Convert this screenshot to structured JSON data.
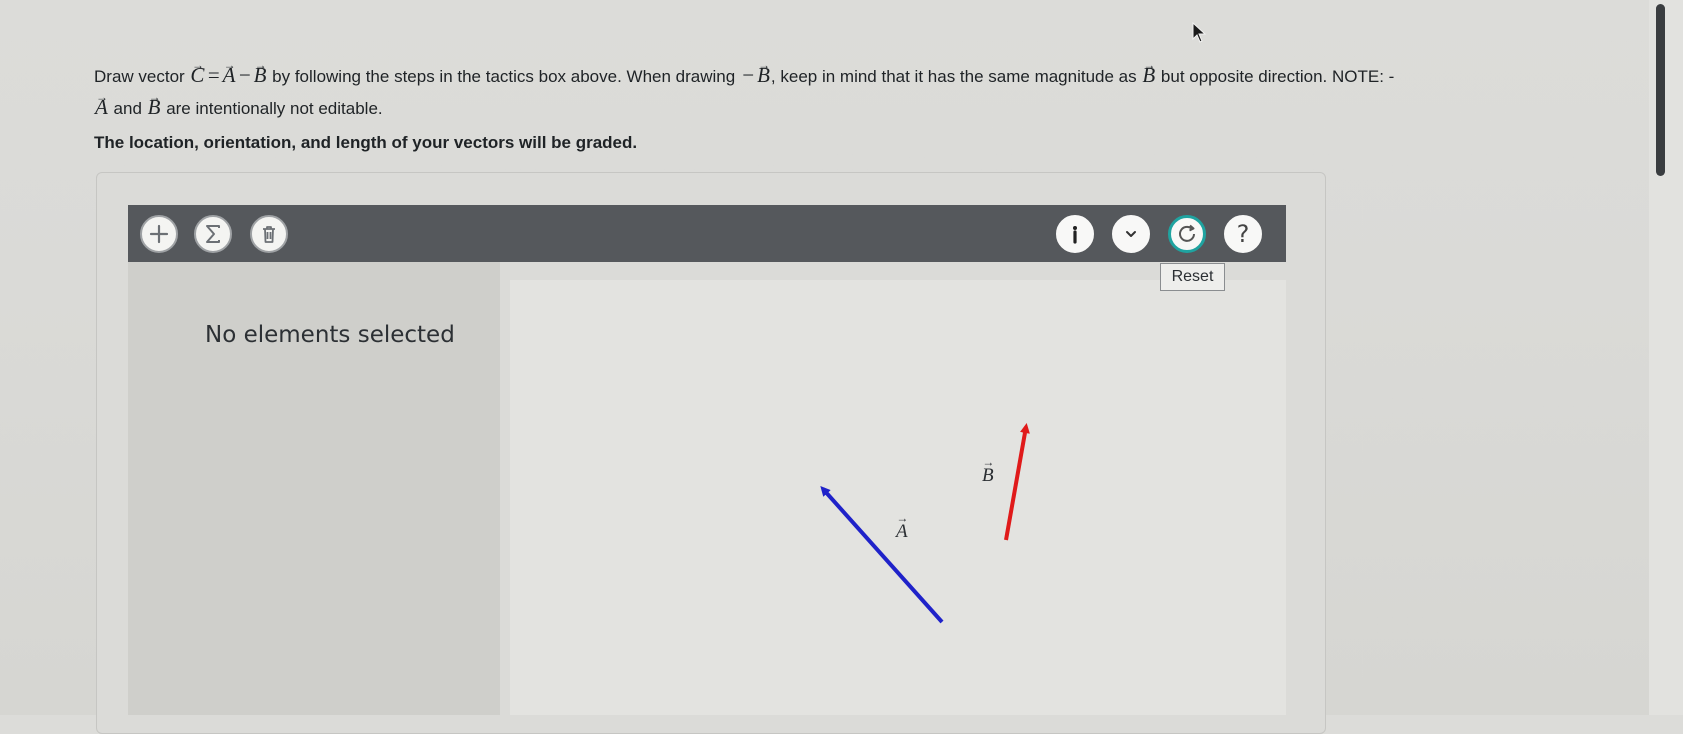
{
  "prompt": {
    "t1": "Draw vector ",
    "C": "C",
    "eq": " = ",
    "A": "A",
    "minus": " − ",
    "B": "B",
    "t2": " by following the steps in the tactics box above. When drawing ",
    "negB_minus": "−",
    "negB": "B",
    "t3": ", keep in mind that it has the same magnitude as ",
    "B2": "B",
    "t4": " but opposite direction. NOTE: -",
    "A2": "A",
    "t5": " and ",
    "B3": "B",
    "t6": " are intentionally not editable."
  },
  "grading_note": "The location, orientation, and length of your vectors will be graded.",
  "toolbar": {
    "add_icon": "plus-icon",
    "sum_icon": "sigma-icon",
    "delete_icon": "trash-icon",
    "info_icon": "info-icon",
    "dropdown_icon": "chevron-down-icon",
    "reset_icon": "reset-icon",
    "help_icon": "question-icon",
    "help_glyph": "?",
    "reset_tooltip": "Reset",
    "accent_color": "#1fa3a0"
  },
  "side_panel": {
    "status": "No elements selected"
  },
  "vectors": [
    {
      "name": "A",
      "label": "A",
      "color": "#1f22c9"
    },
    {
      "name": "B",
      "label": "B",
      "color": "#e01a1a"
    }
  ]
}
